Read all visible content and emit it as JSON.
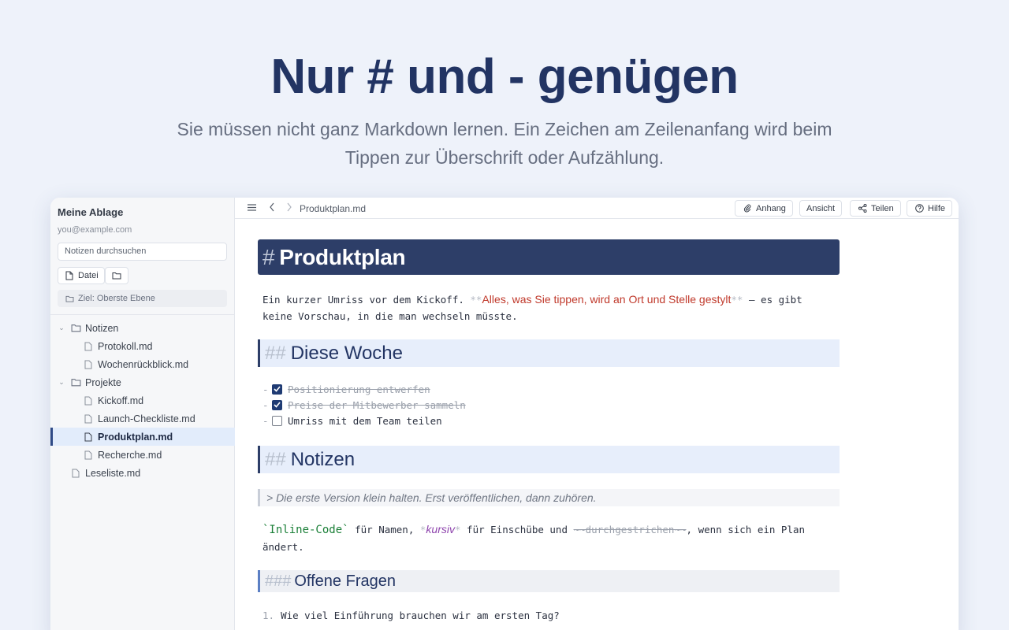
{
  "hero": {
    "title": "Nur # und - genügen",
    "subtitle_line1": "Sie müssen nicht ganz Markdown lernen. Ein Zeichen am Zeilenanfang wird beim",
    "subtitle_line2": "Tippen zur Überschrift oder Aufzählung."
  },
  "sidebar": {
    "title": "Meine Ablage",
    "email": "you@example.com",
    "search_placeholder": "Notizen durchsuchen",
    "new_file_label": "Datei",
    "target_label": "Ziel: Oberste Ebene",
    "tree": [
      {
        "label": "Notizen",
        "type": "folder",
        "depth": 0
      },
      {
        "label": "Protokoll.md",
        "type": "file",
        "depth": 1
      },
      {
        "label": "Wochenrückblick.md",
        "type": "file",
        "depth": 1
      },
      {
        "label": "Projekte",
        "type": "folder",
        "depth": 0
      },
      {
        "label": "Kickoff.md",
        "type": "file",
        "depth": 1
      },
      {
        "label": "Launch-Checkliste.md",
        "type": "file",
        "depth": 1
      },
      {
        "label": "Produktplan.md",
        "type": "file",
        "depth": 1,
        "active": true
      },
      {
        "label": "Recherche.md",
        "type": "file",
        "depth": 1
      },
      {
        "label": "Leseliste.md",
        "type": "file",
        "depth": 0
      }
    ]
  },
  "topbar": {
    "filename": "Produktplan.md",
    "attach_label": "Anhang",
    "view_label": "Ansicht",
    "share_label": "Teilen",
    "help_label": "Hilfe"
  },
  "editor": {
    "h1_hash": "#",
    "h1": "Produktplan",
    "intro_a": "Ein kurzer Umriss vor dem Kickoff. ",
    "bold_marker": "**",
    "intro_bold": "Alles, was Sie tippen, wird an Ort und Stelle gestylt",
    "intro_b": " — es gibt",
    "intro_c": "keine Vorschau, in die man wechseln müsste.",
    "h2_hash": "##",
    "h2_week": "Diese Woche",
    "task_dash": "-",
    "tasks": [
      {
        "text": "Positionierung entwerfen",
        "done": true
      },
      {
        "text": "Preise der Mitbewerber sammeln",
        "done": true
      },
      {
        "text": "Umriss mit dem Team teilen",
        "done": false
      }
    ],
    "h2_notes": "Notizen",
    "quote": "> Die erste Version klein halten. Erst veröffentlichen, dann zuhören.",
    "code": "`Inline-Code`",
    "line_a": " für Namen, ",
    "italic_marker": "*",
    "italic": "kursiv",
    "line_b": " für Einschübe und ",
    "strike": "~~durchgestrichen~~",
    "line_c": ", wenn sich ein Plan",
    "line_d": "ändert.",
    "h3_hash": "###",
    "h3": "Offene Fragen",
    "questions": [
      {
        "num": "1.",
        "text": "Wie viel Einführung brauchen wir am ersten Tag?"
      }
    ]
  }
}
